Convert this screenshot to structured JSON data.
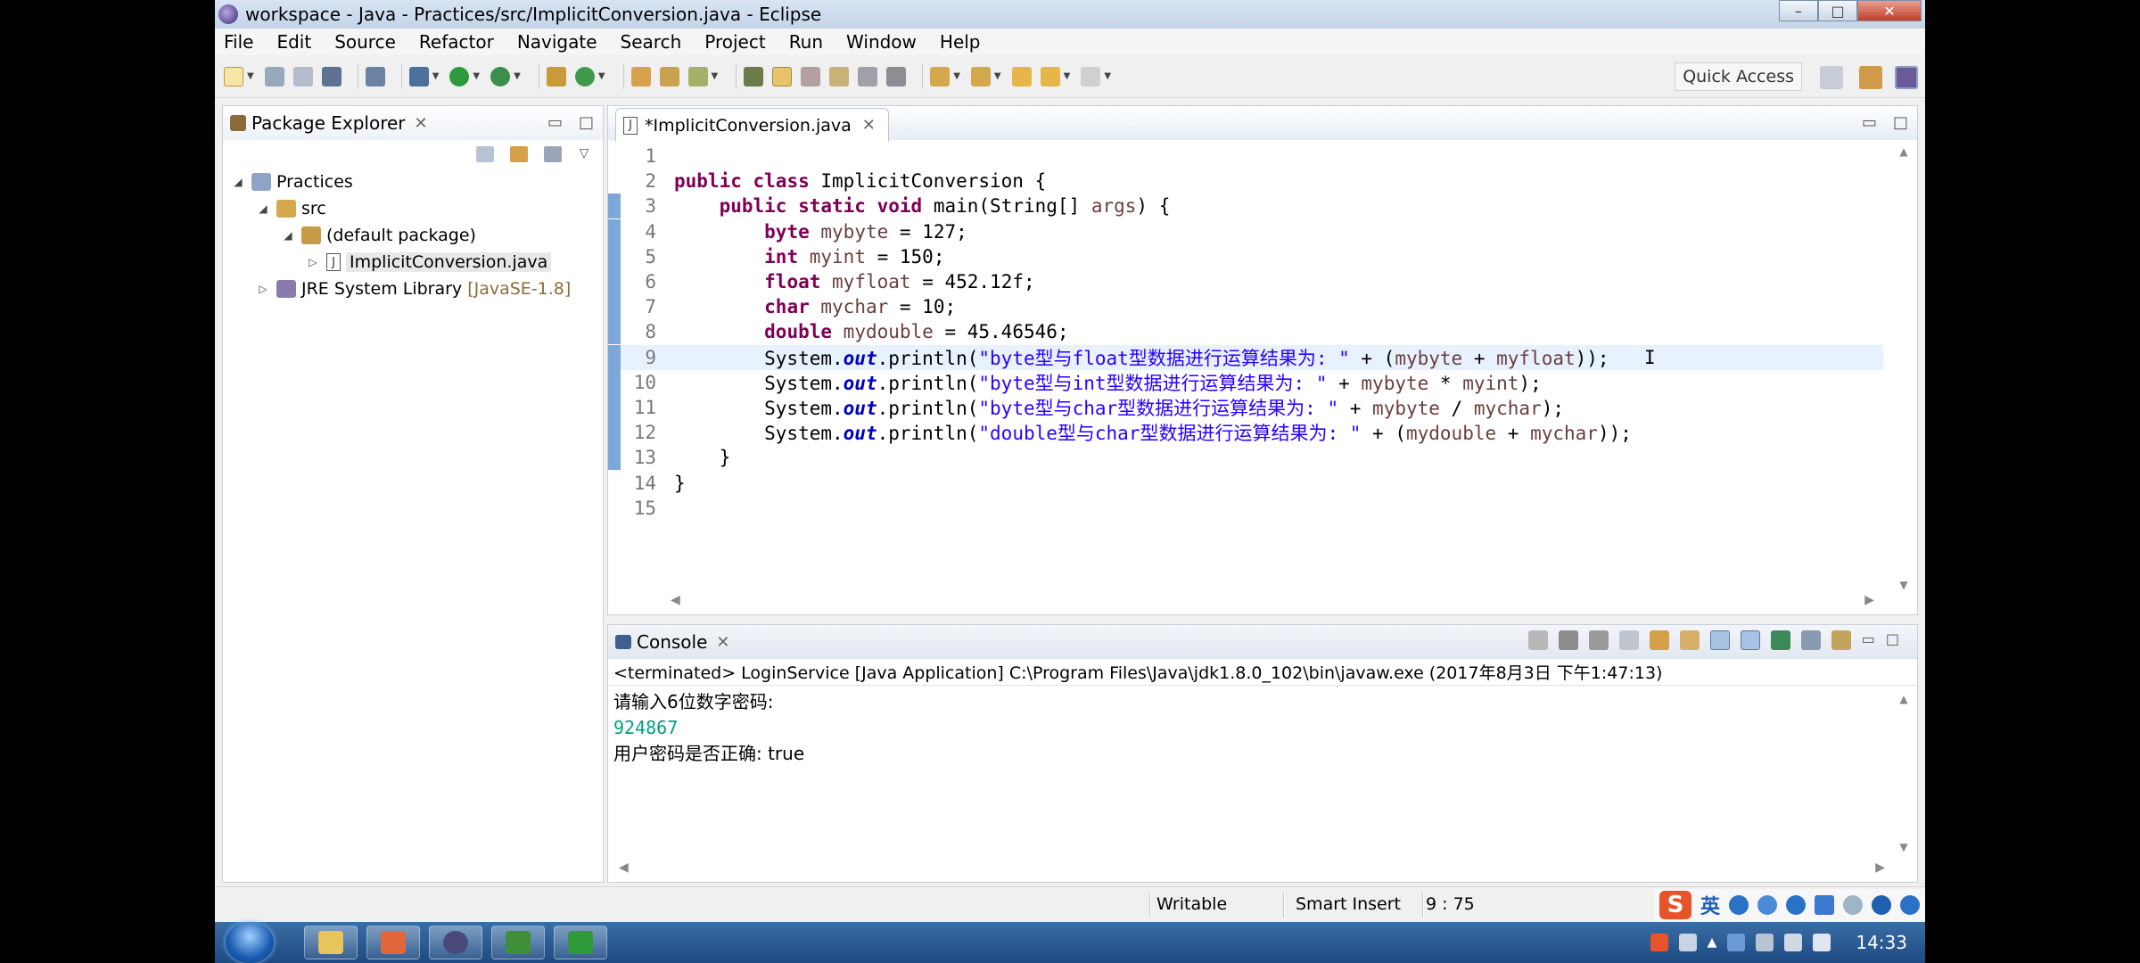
{
  "window": {
    "title": "workspace - Java - Practices/src/ImplicitConversion.java - Eclipse",
    "controls": [
      "–",
      "□",
      "✕"
    ]
  },
  "menu": [
    "File",
    "Edit",
    "Source",
    "Refactor",
    "Navigate",
    "Search",
    "Project",
    "Run",
    "Window",
    "Help"
  ],
  "toolbar": {
    "quick_access": "Quick Access"
  },
  "package_explorer": {
    "title": "Package Explorer",
    "tree": [
      {
        "label": "Practices",
        "arrow": "◢",
        "dim": ""
      },
      {
        "label": "src",
        "arrow": "◢",
        "dim": ""
      },
      {
        "label": "(default package)",
        "arrow": "◢",
        "dim": ""
      },
      {
        "label": "ImplicitConversion.java",
        "arrow": "▷",
        "dim": ""
      },
      {
        "label": "JRE System Library",
        "arrow": "▷",
        "dim": "[JavaSE-1.8]"
      }
    ]
  },
  "editor": {
    "tab": "*ImplicitConversion.java",
    "current_line": 9,
    "lines": [
      {
        "n": "1",
        "code": ""
      },
      {
        "n": "2",
        "code": "public class ImplicitConversion {"
      },
      {
        "n": "3",
        "code": "    public static void main(String[] args) {"
      },
      {
        "n": "4",
        "code": "        byte mybyte = 127;"
      },
      {
        "n": "5",
        "code": "        int myint = 150;"
      },
      {
        "n": "6",
        "code": "        float myfloat = 452.12f;"
      },
      {
        "n": "7",
        "code": "        char mychar = 10;"
      },
      {
        "n": "8",
        "code": "        double mydouble = 45.46546;"
      },
      {
        "n": "9",
        "code": "        System.out.println(\"byte型与float型数据进行运算结果为: \" + (mybyte + myfloat));"
      },
      {
        "n": "10",
        "code": "        System.out.println(\"byte型与int型数据进行运算结果为: \" + mybyte * myint);"
      },
      {
        "n": "11",
        "code": "        System.out.println(\"byte型与char型数据进行运算结果为: \" + mybyte / mychar);"
      },
      {
        "n": "12",
        "code": "        System.out.println(\"double型与char型数据进行运算结果为: \" + (mydouble + mychar));"
      },
      {
        "n": "13",
        "code": "    }"
      },
      {
        "n": "14",
        "code": "}"
      },
      {
        "n": "15",
        "code": ""
      }
    ]
  },
  "console": {
    "title": "Console",
    "status": "<terminated> LoginService [Java Application] C:\\Program Files\\Java\\jdk1.8.0_102\\bin\\javaw.exe (2017年8月3日 下午1:47:13)",
    "output": [
      {
        "text": "请输入6位数字密码:",
        "kind": "out"
      },
      {
        "text": "924867",
        "kind": "input"
      },
      {
        "text": "用户密码是否正确: true",
        "kind": "out"
      }
    ]
  },
  "statusbar": {
    "writable": "Writable",
    "insert_mode": "Smart Insert",
    "position": "9 : 75",
    "ime_lang": "英"
  },
  "taskbar": {
    "clock": "14:33"
  }
}
